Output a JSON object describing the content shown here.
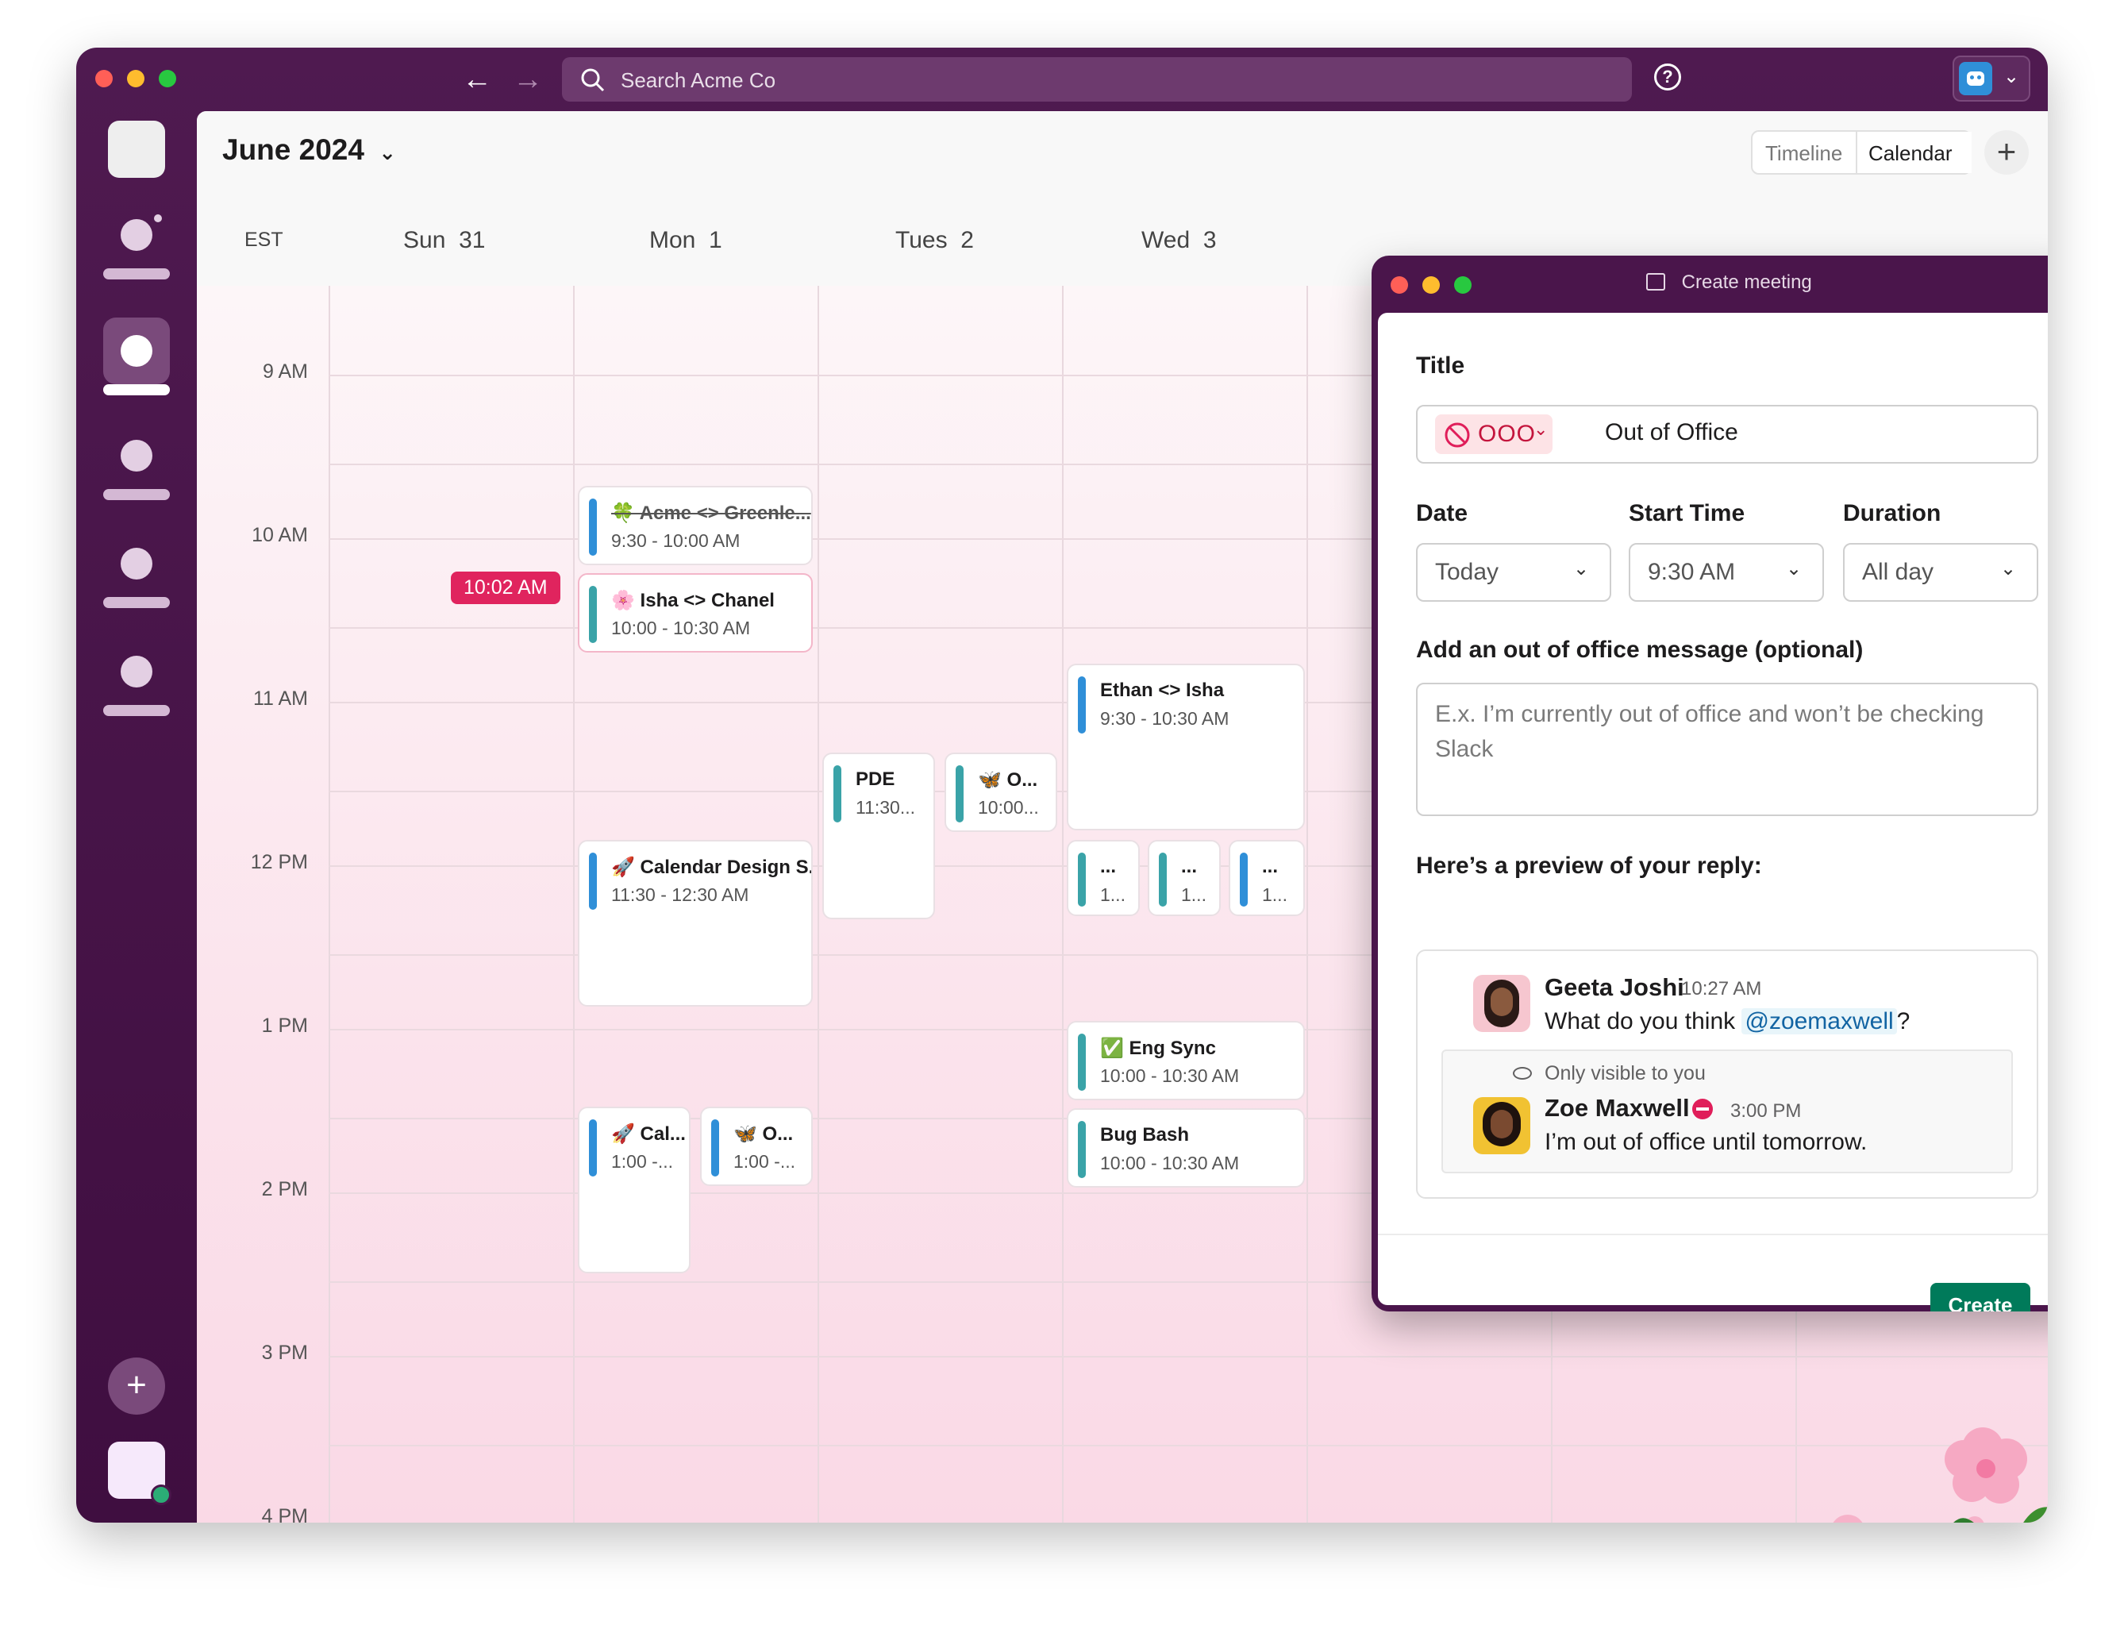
{
  "titlebar": {
    "search_placeholder": "Search Acme Co",
    "help_icon": "help-circle-icon",
    "back_icon": "arrow-left-icon",
    "forward_icon": "arrow-right-icon"
  },
  "calendar": {
    "month": "June 2024",
    "view_options": [
      "Timeline",
      "Calendar"
    ],
    "active_view": "Calendar",
    "timezone": "EST",
    "days": [
      {
        "name": "Sun",
        "num": "31"
      },
      {
        "name": "Mon",
        "num": "1"
      },
      {
        "name": "Tues",
        "num": "2"
      },
      {
        "name": "Wed",
        "num": "3"
      }
    ],
    "times": [
      "9 AM",
      "10 AM",
      "11 AM",
      "12 PM",
      "1 PM",
      "2 PM",
      "3 PM",
      "4 PM"
    ],
    "now_label": "10:02 AM",
    "events": [
      {
        "title": "🍀 Acme <> Greenle...",
        "time": "9:30 - 10:00 AM"
      },
      {
        "title": "🌸 Isha <> Chanel",
        "time": "10:00 - 10:30 AM"
      },
      {
        "title": "Ethan <> Isha",
        "time": "9:30 - 10:30 AM"
      },
      {
        "title": "PDE",
        "time": "11:30..."
      },
      {
        "title": "🦋 O...",
        "time": "10:00..."
      },
      {
        "title": "🚀 Calendar Design S...",
        "time": "11:30 - 12:30 AM"
      },
      {
        "title": "...",
        "time": "1..."
      },
      {
        "title": "...",
        "time": "1..."
      },
      {
        "title": "...",
        "time": "1..."
      },
      {
        "title": "✅ Eng Sync",
        "time": "10:00 - 10:30 AM"
      },
      {
        "title": "🚀 Cal...",
        "time": "1:00 -..."
      },
      {
        "title": "🦋 O...",
        "time": "1:00 -..."
      },
      {
        "title": "Bug Bash",
        "time": "10:00 - 10:30 AM"
      }
    ],
    "colors": {
      "accent_teal": "#3aa3a8",
      "accent_blue": "#2f8fd8",
      "now_red": "#e0245e"
    }
  },
  "modal": {
    "window_title": "Create meeting",
    "title_label": "Title",
    "status_chip": "OOO",
    "title_value": "Out of Office",
    "date_label": "Date",
    "date_value": "Today",
    "start_time_label": "Start Time",
    "start_time_value": "9:30 AM",
    "duration_label": "Duration",
    "duration_value": "All day",
    "message_label": "Add an out of office message (optional)",
    "message_placeholder": "E.x. I’m currently out of office and won’t be checking Slack",
    "preview_label": "Here’s a preview of your reply:",
    "preview": {
      "sender1": "Geeta Joshi",
      "time1": "10:27 AM",
      "message1_prefix": "What do you think",
      "mention": "@zoemaxwell",
      "message1_suffix": "?",
      "visibility": "Only visible to you",
      "sender2": "Zoe Maxwell",
      "time2": "3:00 PM",
      "message2": "I’m out of office until tomorrow."
    },
    "create_label": "Create",
    "create_color": "#007a5a"
  }
}
